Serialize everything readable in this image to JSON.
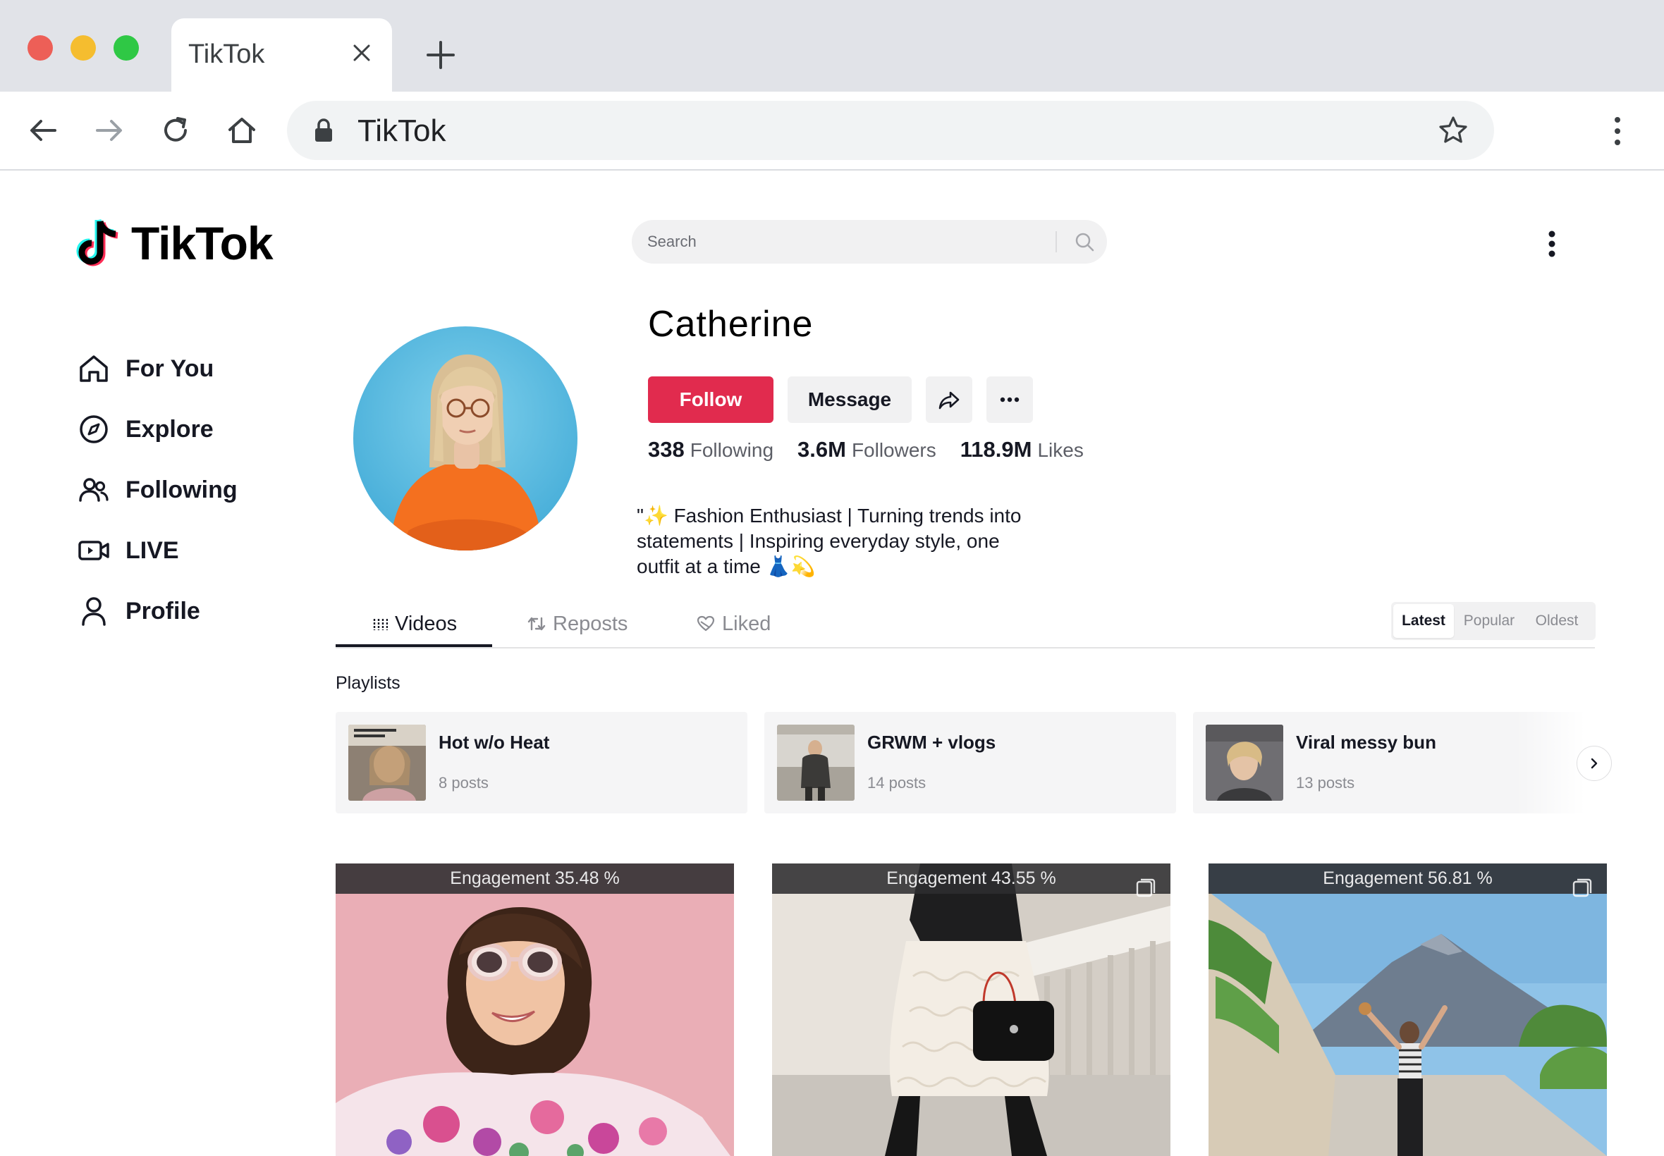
{
  "browser": {
    "tab_title": "TikTok",
    "address": "TikTok"
  },
  "tiktok": {
    "logo_text": "TikTok",
    "search_placeholder": "Search",
    "nav": [
      {
        "label": "For You",
        "icon": "home-icon"
      },
      {
        "label": "Explore",
        "icon": "compass-icon"
      },
      {
        "label": "Following",
        "icon": "users-icon"
      },
      {
        "label": "LIVE",
        "icon": "live-icon"
      },
      {
        "label": "Profile",
        "icon": "user-icon"
      }
    ]
  },
  "profile": {
    "name": "Catherine",
    "follow_label": "Follow",
    "message_label": "Message",
    "stats": [
      {
        "value": "338",
        "label": "Following"
      },
      {
        "value": "3.6M",
        "label": "Followers"
      },
      {
        "value": "118.9M",
        "label": "Likes"
      }
    ],
    "bio": "\"✨ Fashion Enthusiast | Turning trends into statements | Inspiring everyday style, one outfit at a time 👗💫"
  },
  "tabs": [
    {
      "label": "Videos",
      "icon": "grid-icon",
      "active": true
    },
    {
      "label": "Reposts",
      "icon": "repost-icon",
      "active": false
    },
    {
      "label": "Liked",
      "icon": "heart-icon",
      "active": false
    }
  ],
  "sort": {
    "options": [
      "Latest",
      "Popular",
      "Oldest"
    ],
    "selected": "Latest"
  },
  "playlists": {
    "heading": "Playlists",
    "items": [
      {
        "title": "Hot w/o Heat",
        "count": "8 posts"
      },
      {
        "title": "GRWM + vlogs",
        "count": "14 posts"
      },
      {
        "title": "Viral messy bun",
        "count": "13 posts"
      }
    ]
  },
  "videos": [
    {
      "engagement": "Engagement 35.48 %"
    },
    {
      "engagement": "Engagement 43.55 %"
    },
    {
      "engagement": "Engagement 56.81 %"
    }
  ],
  "colors": {
    "follow": "#e12b4e",
    "text": "#161823",
    "muted": "#8a8b91",
    "avatar_bg": "#5bbde0",
    "sweater": "#f4701f"
  }
}
